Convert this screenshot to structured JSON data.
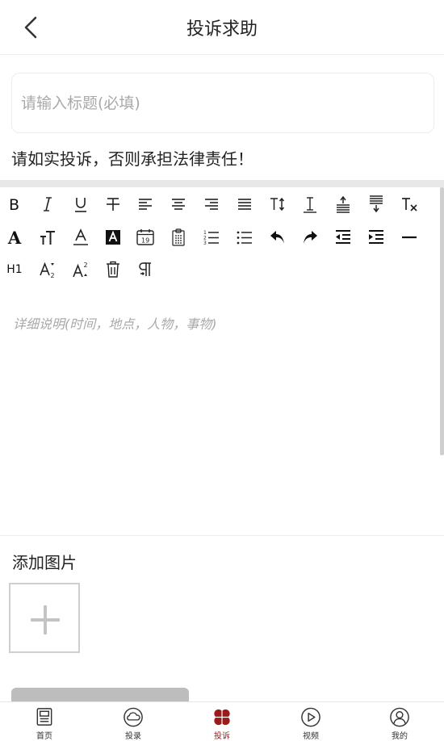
{
  "header": {
    "title": "投诉求助",
    "back_icon": "chevron-left-icon"
  },
  "form": {
    "title_placeholder": "请输入标题(必填)",
    "title_value": "",
    "notice": "请如实投诉，否则承担法律责任！",
    "editor_placeholder": "详细说明(时间，地点，人物，事物)",
    "add_image_label": "添加图片"
  },
  "toolbar": {
    "text_labels": {
      "heading_h1": "H1",
      "big_a": "A"
    },
    "icons": [
      "bold-icon",
      "italic-icon",
      "underline-icon",
      "strikethrough-icon",
      "align-left-icon",
      "align-center-icon",
      "align-right-icon",
      "align-justify-icon",
      "font-size-icon",
      "line-height-icon",
      "space-before-icon",
      "space-after-icon",
      "clear-format-icon",
      "font-icon",
      "text-size-icon",
      "font-color-icon",
      "background-color-icon",
      "date-icon",
      "clipboard-icon",
      "ordered-list-icon",
      "unordered-list-icon",
      "undo-icon",
      "redo-icon",
      "outdent-icon",
      "indent-icon",
      "horizontal-rule-icon",
      "heading-icon",
      "subscript-icon",
      "superscript-icon",
      "delete-icon",
      "paragraph-icon"
    ]
  },
  "tabbar": {
    "items": [
      {
        "label": "首页",
        "icon": "home-news-icon",
        "active": false
      },
      {
        "label": "投录",
        "icon": "upload-cloud-icon",
        "active": false
      },
      {
        "label": "投诉",
        "icon": "clover-icon",
        "active": true
      },
      {
        "label": "视频",
        "icon": "play-icon",
        "active": false
      },
      {
        "label": "我的",
        "icon": "user-icon",
        "active": false
      }
    ]
  },
  "colors": {
    "accent": "#9b1b1b",
    "divider": "#e8e8e8",
    "placeholder": "#a9a9a9",
    "button_disabled": "#bdbdbd"
  }
}
